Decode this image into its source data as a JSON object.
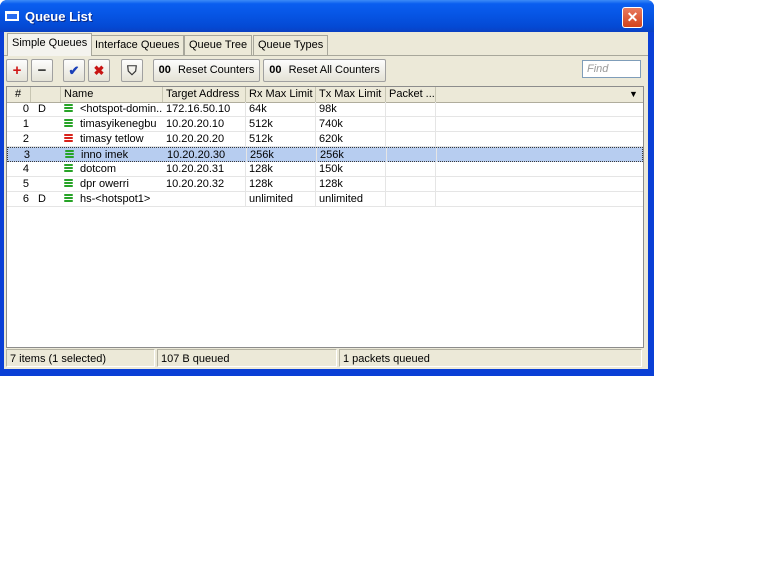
{
  "window": {
    "title": "Queue List",
    "close_glyph": "✕"
  },
  "tabs": [
    {
      "label": "Simple Queues",
      "active": true
    },
    {
      "label": "Interface Queues"
    },
    {
      "label": "Queue Tree"
    },
    {
      "label": "Queue Types"
    }
  ],
  "toolbar": {
    "add_glyph": "+",
    "remove_glyph": "−",
    "enable_glyph": "✔",
    "disable_glyph": "✖",
    "filter_glyph": "⛉",
    "reset_counters_prefix": "00",
    "reset_counters_label": "Reset Counters",
    "reset_all_prefix": "00",
    "reset_all_label": "Reset All Counters",
    "find_placeholder": "Find"
  },
  "table": {
    "columns": [
      "#",
      "",
      "Name",
      "Target Address",
      "Rx Max Limit",
      "Tx Max Limit",
      "Packet ..."
    ],
    "dropdown_glyph": "▼",
    "rows": [
      {
        "num": "0",
        "flag": "D",
        "name": "<hotspot-domin...",
        "target": "172.16.50.10",
        "rx": "64k",
        "tx": "98k",
        "icon": "green",
        "selected": false
      },
      {
        "num": "1",
        "flag": "",
        "name": "timasyikenegbu",
        "target": "10.20.20.10",
        "rx": "512k",
        "tx": "740k",
        "icon": "green",
        "selected": false
      },
      {
        "num": "2",
        "flag": "",
        "name": "timasy tetlow",
        "target": "10.20.20.20",
        "rx": "512k",
        "tx": "620k",
        "icon": "red",
        "selected": false
      },
      {
        "num": "3",
        "flag": "",
        "name": "inno imek",
        "target": "10.20.20.30",
        "rx": "256k",
        "tx": "256k",
        "icon": "green",
        "selected": true
      },
      {
        "num": "4",
        "flag": "",
        "name": "dotcom",
        "target": "10.20.20.31",
        "rx": "128k",
        "tx": "150k",
        "icon": "green",
        "selected": false
      },
      {
        "num": "5",
        "flag": "",
        "name": "dpr owerri",
        "target": "10.20.20.32",
        "rx": "128k",
        "tx": "128k",
        "icon": "green",
        "selected": false
      },
      {
        "num": "6",
        "flag": "D",
        "name": "hs-<hotspot1>",
        "target": "",
        "rx": "unlimited",
        "tx": "unlimited",
        "icon": "green",
        "selected": false
      }
    ]
  },
  "status": {
    "items": "7 items (1 selected)",
    "queued_bytes": "107 B queued",
    "queued_packets": "1 packets queued"
  },
  "colors": {
    "icon_green": "#27a327",
    "icon_red": "#d8231b",
    "selection": "#b7cdf0",
    "titlebar": "#0654e3"
  }
}
